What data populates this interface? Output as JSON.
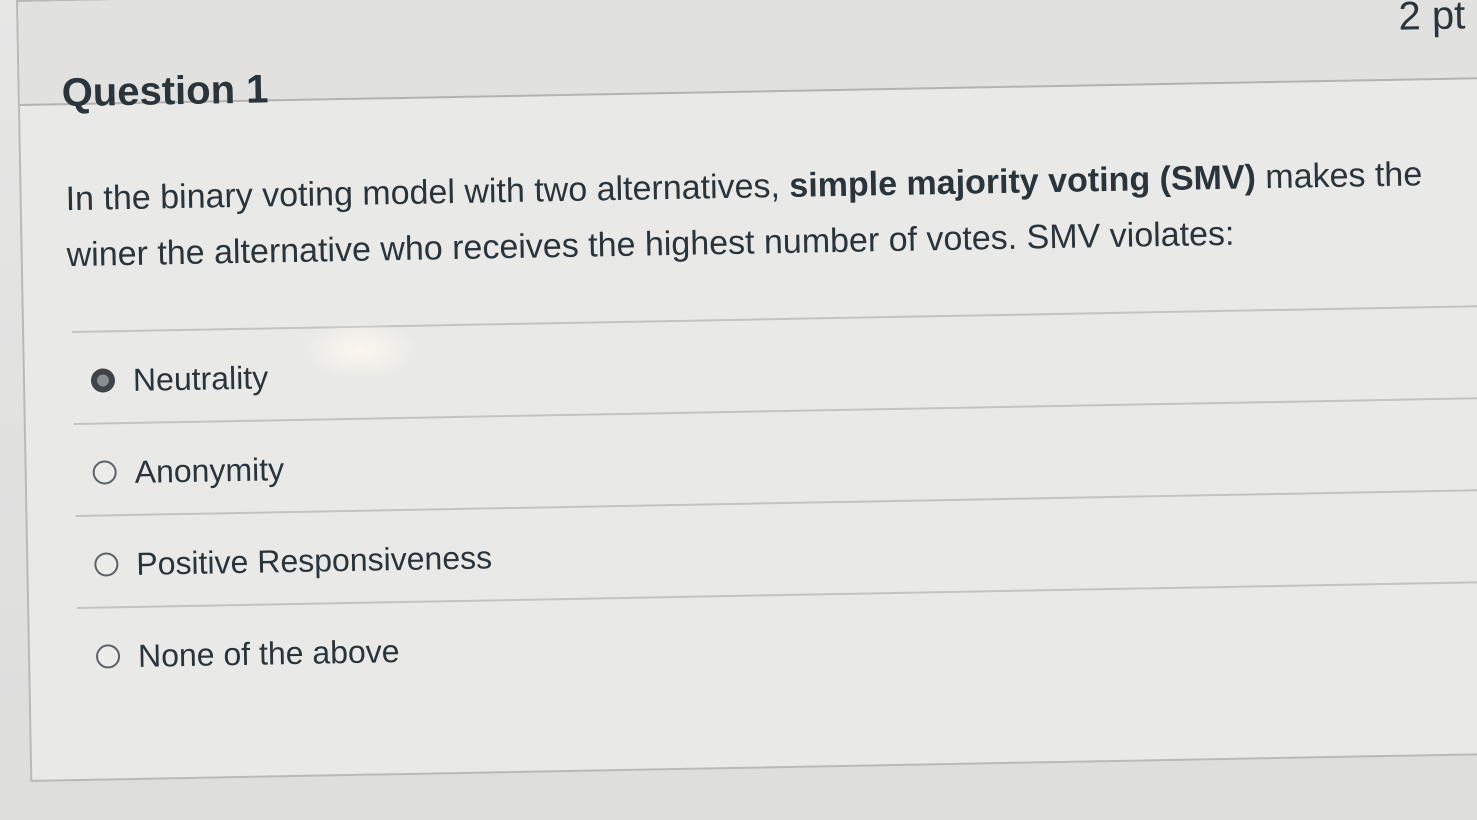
{
  "question": {
    "title": "Question 1",
    "points": "2 pt",
    "prompt_before_bold": "In the binary voting model with two alternatives, ",
    "prompt_bold": "simple majority voting (SMV)",
    "prompt_after_bold": " makes the winer the alternative who receives the highest number of votes. SMV violates:",
    "answers": [
      {
        "label": "Neutrality",
        "selected": true
      },
      {
        "label": "Anonymity",
        "selected": false
      },
      {
        "label": "Positive Responsiveness",
        "selected": false
      },
      {
        "label": "None of the above",
        "selected": false
      }
    ]
  }
}
